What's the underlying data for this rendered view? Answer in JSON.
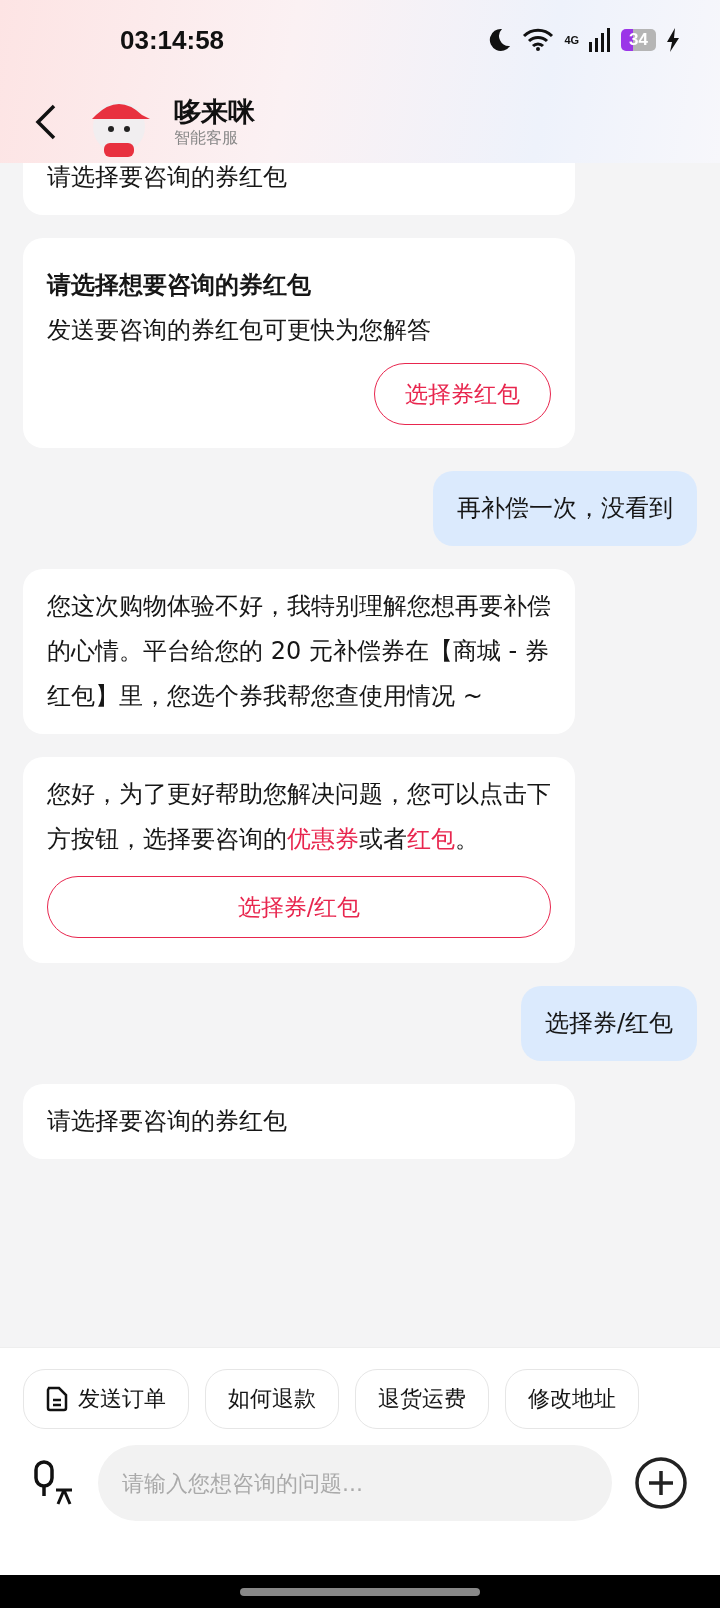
{
  "status_bar": {
    "time": "03:14:58",
    "network": "4G",
    "battery": "34"
  },
  "header": {
    "name": "哆来咪",
    "subtitle": "智能客服"
  },
  "messages": [
    {
      "kind": "bot_text",
      "text": "请选择要咨询的券红包",
      "clipped": true
    },
    {
      "kind": "bot_card",
      "title": "请选择想要咨询的券红包",
      "body": "发送要咨询的券红包可更快为您解答",
      "button": "选择券红包"
    },
    {
      "kind": "user_text",
      "text": "再补偿一次，没看到"
    },
    {
      "kind": "bot_text",
      "text": "您这次购物体验不好，我特别理解您想再要补偿的心情。平台给您的 20 元补偿券在【商城 - 券红包】里，您选个券我帮您查使用情况 ~",
      "clipped": false
    },
    {
      "kind": "bot_rich",
      "segments": [
        {
          "text": "您好，为了更好帮助您解决问题，您可以点击下方按钮，选择要咨询的",
          "highlight": false
        },
        {
          "text": "优惠券",
          "highlight": true
        },
        {
          "text": "或者",
          "highlight": false
        },
        {
          "text": "红包",
          "highlight": true
        },
        {
          "text": "。",
          "highlight": false
        }
      ],
      "button": "选择券/红包"
    },
    {
      "kind": "user_text",
      "text": "选择券/红包"
    },
    {
      "kind": "bot_text",
      "text": "请选择要咨询的券红包",
      "clipped": false
    }
  ],
  "quick_replies": [
    {
      "label": "发送订单",
      "kind": "order"
    },
    {
      "label": "如何退款",
      "kind": "plain"
    },
    {
      "label": "退货运费",
      "kind": "plain"
    },
    {
      "label": "修改地址",
      "kind": "plain"
    }
  ],
  "input": {
    "placeholder": "请输入您想咨询的问题..."
  }
}
